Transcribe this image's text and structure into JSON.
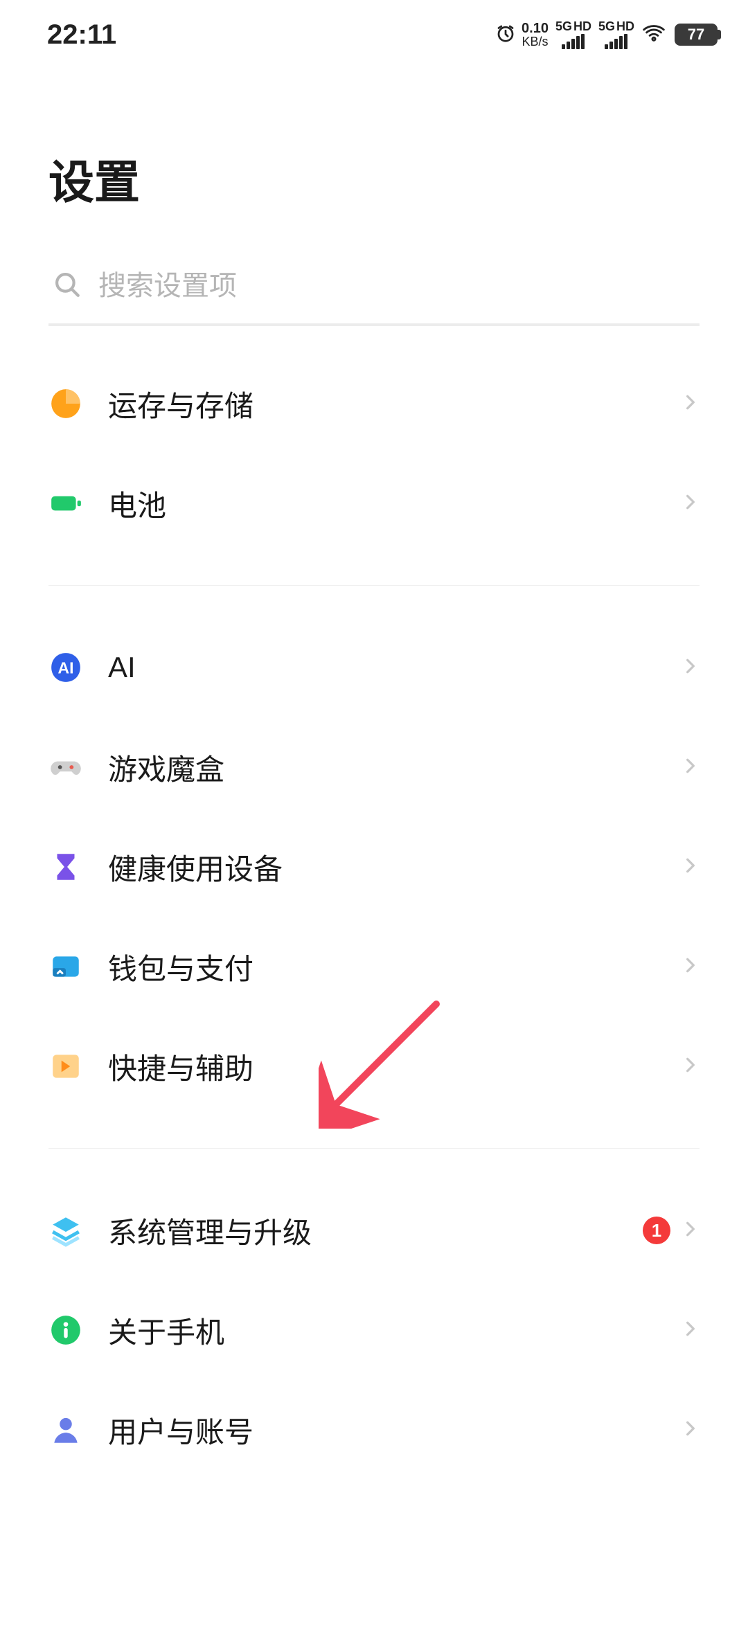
{
  "status": {
    "time": "22:11",
    "speed_value": "0.10",
    "speed_unit": "KB/s",
    "sig1_label_left": "5G",
    "sig1_label_right": "HD",
    "sig2_label_left": "5G",
    "sig2_label_right": "HD",
    "battery": "77"
  },
  "page": {
    "title": "设置"
  },
  "search": {
    "placeholder": "搜索设置项"
  },
  "items": {
    "storage": {
      "label": "运存与存储"
    },
    "battery": {
      "label": "电池"
    },
    "ai": {
      "label": "AI",
      "icon_text": "AI"
    },
    "gamebox": {
      "label": "游戏魔盒"
    },
    "health": {
      "label": "健康使用设备"
    },
    "wallet": {
      "label": "钱包与支付"
    },
    "shortcut": {
      "label": "快捷与辅助"
    },
    "system": {
      "label": "系统管理与升级",
      "badge": "1"
    },
    "about": {
      "label": "关于手机"
    },
    "account": {
      "label": "用户与账号"
    }
  }
}
